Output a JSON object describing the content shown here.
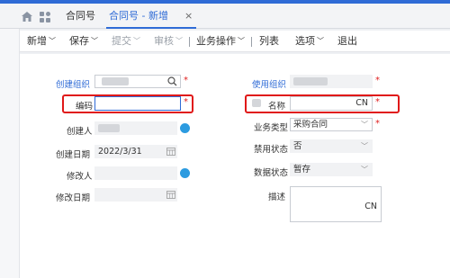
{
  "tabs": {
    "contract_tab": "合同号",
    "active_tab": "合同号 - 新增",
    "close": "×"
  },
  "toolbar": {
    "new": "新增",
    "save": "保存",
    "submit": "提交",
    "audit": "审核",
    "business": "业务操作",
    "list": "列表",
    "options": "选项",
    "exit": "退出",
    "caret": "﹀"
  },
  "form": {
    "creator_org_label": "创建组织",
    "code_label": "编码",
    "creator_label": "创建人",
    "create_date_label": "创建日期",
    "create_date_value": "2022/3/31",
    "modifier_label": "修改人",
    "modify_date_label": "修改日期",
    "user_org_label": "使用组织",
    "name_label": "名称",
    "name_value": "CN",
    "business_type_label": "业务类型",
    "business_type_value": "采购合同",
    "forbid_status_label": "禁用状态",
    "forbid_status_value": "否",
    "data_status_label": "数据状态",
    "data_status_value": "暂存",
    "desc_label": "描述",
    "desc_value": "CN",
    "required_mark": "*"
  },
  "colors": {
    "accent": "#2f6bd6",
    "highlight_box": "#e01818",
    "required": "#e02020"
  }
}
